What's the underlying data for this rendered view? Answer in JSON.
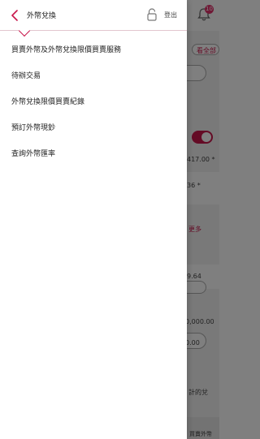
{
  "drawer": {
    "title": "外幣兌換",
    "logout_label": "登出",
    "menu": [
      "買賣外幣及外幣兌換限價買賣服務",
      "待辦交易",
      "外幣兌換限價買賣紀錄",
      "預訂外幣現鈔",
      "查詢外幣匯率"
    ]
  },
  "background": {
    "notification_count": "10",
    "fragments": {
      "f1": "看全部",
      "f2": "417.00 *",
      "f3": "36 *",
      "f4": "更多",
      "f5": "9.64",
      "f6": "9.64",
      "f7": "0,000.00",
      "f8": "0.00",
      "f9": "計的兌",
      "f10": "買賣外幣"
    }
  },
  "colors": {
    "accent": "#c8164b",
    "badge": "#e0306b"
  }
}
